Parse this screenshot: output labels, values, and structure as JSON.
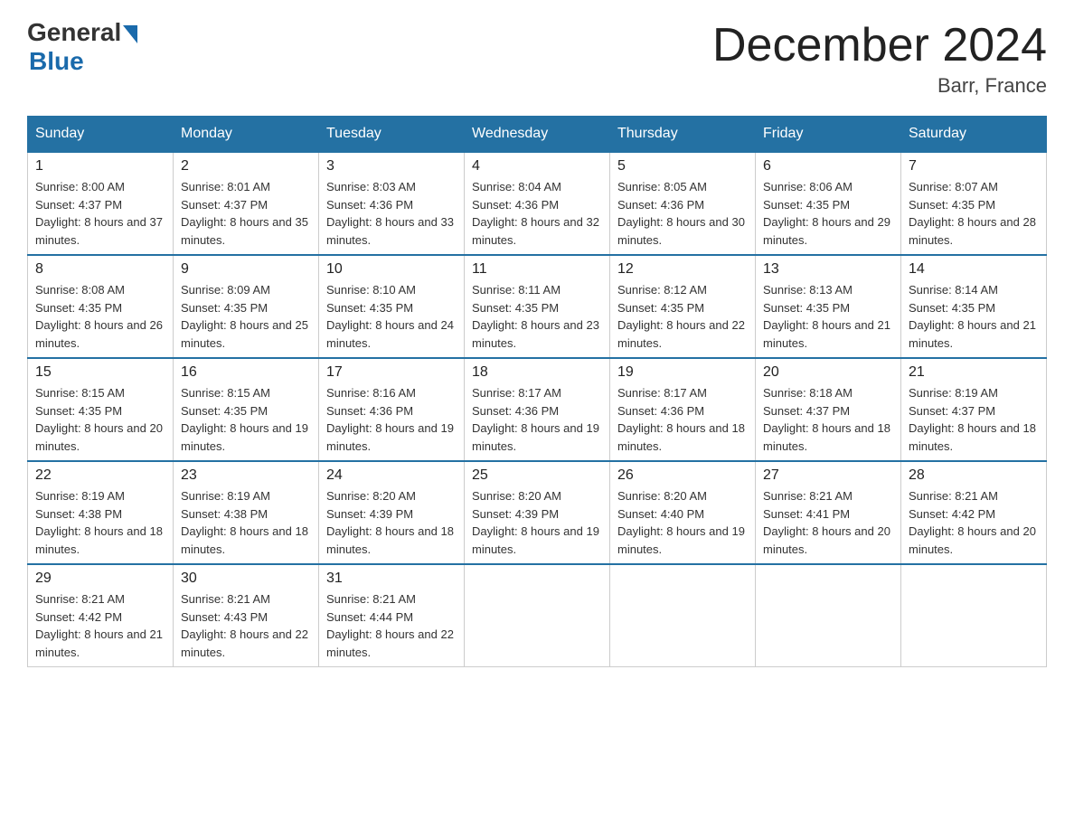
{
  "header": {
    "logo_general": "General",
    "logo_blue": "Blue",
    "title": "December 2024",
    "location": "Barr, France"
  },
  "days_of_week": [
    "Sunday",
    "Monday",
    "Tuesday",
    "Wednesday",
    "Thursday",
    "Friday",
    "Saturday"
  ],
  "weeks": [
    [
      {
        "day": "1",
        "sunrise": "8:00 AM",
        "sunset": "4:37 PM",
        "daylight": "8 hours and 37 minutes."
      },
      {
        "day": "2",
        "sunrise": "8:01 AM",
        "sunset": "4:37 PM",
        "daylight": "8 hours and 35 minutes."
      },
      {
        "day": "3",
        "sunrise": "8:03 AM",
        "sunset": "4:36 PM",
        "daylight": "8 hours and 33 minutes."
      },
      {
        "day": "4",
        "sunrise": "8:04 AM",
        "sunset": "4:36 PM",
        "daylight": "8 hours and 32 minutes."
      },
      {
        "day": "5",
        "sunrise": "8:05 AM",
        "sunset": "4:36 PM",
        "daylight": "8 hours and 30 minutes."
      },
      {
        "day": "6",
        "sunrise": "8:06 AM",
        "sunset": "4:35 PM",
        "daylight": "8 hours and 29 minutes."
      },
      {
        "day": "7",
        "sunrise": "8:07 AM",
        "sunset": "4:35 PM",
        "daylight": "8 hours and 28 minutes."
      }
    ],
    [
      {
        "day": "8",
        "sunrise": "8:08 AM",
        "sunset": "4:35 PM",
        "daylight": "8 hours and 26 minutes."
      },
      {
        "day": "9",
        "sunrise": "8:09 AM",
        "sunset": "4:35 PM",
        "daylight": "8 hours and 25 minutes."
      },
      {
        "day": "10",
        "sunrise": "8:10 AM",
        "sunset": "4:35 PM",
        "daylight": "8 hours and 24 minutes."
      },
      {
        "day": "11",
        "sunrise": "8:11 AM",
        "sunset": "4:35 PM",
        "daylight": "8 hours and 23 minutes."
      },
      {
        "day": "12",
        "sunrise": "8:12 AM",
        "sunset": "4:35 PM",
        "daylight": "8 hours and 22 minutes."
      },
      {
        "day": "13",
        "sunrise": "8:13 AM",
        "sunset": "4:35 PM",
        "daylight": "8 hours and 21 minutes."
      },
      {
        "day": "14",
        "sunrise": "8:14 AM",
        "sunset": "4:35 PM",
        "daylight": "8 hours and 21 minutes."
      }
    ],
    [
      {
        "day": "15",
        "sunrise": "8:15 AM",
        "sunset": "4:35 PM",
        "daylight": "8 hours and 20 minutes."
      },
      {
        "day": "16",
        "sunrise": "8:15 AM",
        "sunset": "4:35 PM",
        "daylight": "8 hours and 19 minutes."
      },
      {
        "day": "17",
        "sunrise": "8:16 AM",
        "sunset": "4:36 PM",
        "daylight": "8 hours and 19 minutes."
      },
      {
        "day": "18",
        "sunrise": "8:17 AM",
        "sunset": "4:36 PM",
        "daylight": "8 hours and 19 minutes."
      },
      {
        "day": "19",
        "sunrise": "8:17 AM",
        "sunset": "4:36 PM",
        "daylight": "8 hours and 18 minutes."
      },
      {
        "day": "20",
        "sunrise": "8:18 AM",
        "sunset": "4:37 PM",
        "daylight": "8 hours and 18 minutes."
      },
      {
        "day": "21",
        "sunrise": "8:19 AM",
        "sunset": "4:37 PM",
        "daylight": "8 hours and 18 minutes."
      }
    ],
    [
      {
        "day": "22",
        "sunrise": "8:19 AM",
        "sunset": "4:38 PM",
        "daylight": "8 hours and 18 minutes."
      },
      {
        "day": "23",
        "sunrise": "8:19 AM",
        "sunset": "4:38 PM",
        "daylight": "8 hours and 18 minutes."
      },
      {
        "day": "24",
        "sunrise": "8:20 AM",
        "sunset": "4:39 PM",
        "daylight": "8 hours and 18 minutes."
      },
      {
        "day": "25",
        "sunrise": "8:20 AM",
        "sunset": "4:39 PM",
        "daylight": "8 hours and 19 minutes."
      },
      {
        "day": "26",
        "sunrise": "8:20 AM",
        "sunset": "4:40 PM",
        "daylight": "8 hours and 19 minutes."
      },
      {
        "day": "27",
        "sunrise": "8:21 AM",
        "sunset": "4:41 PM",
        "daylight": "8 hours and 20 minutes."
      },
      {
        "day": "28",
        "sunrise": "8:21 AM",
        "sunset": "4:42 PM",
        "daylight": "8 hours and 20 minutes."
      }
    ],
    [
      {
        "day": "29",
        "sunrise": "8:21 AM",
        "sunset": "4:42 PM",
        "daylight": "8 hours and 21 minutes."
      },
      {
        "day": "30",
        "sunrise": "8:21 AM",
        "sunset": "4:43 PM",
        "daylight": "8 hours and 22 minutes."
      },
      {
        "day": "31",
        "sunrise": "8:21 AM",
        "sunset": "4:44 PM",
        "daylight": "8 hours and 22 minutes."
      },
      null,
      null,
      null,
      null
    ]
  ]
}
